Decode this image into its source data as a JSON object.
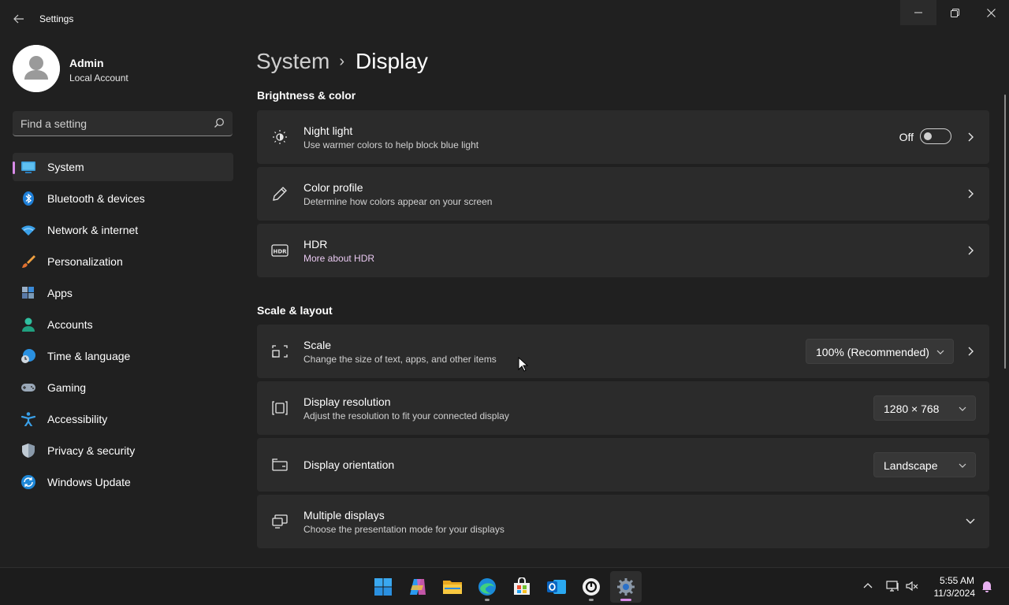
{
  "window": {
    "title": "Settings"
  },
  "profile": {
    "name": "Admin",
    "account_type": "Local Account"
  },
  "search": {
    "placeholder": "Find a setting"
  },
  "sidebar": {
    "items": [
      {
        "label": "System",
        "icon": "system-icon",
        "active": true
      },
      {
        "label": "Bluetooth & devices",
        "icon": "bluetooth-icon"
      },
      {
        "label": "Network & internet",
        "icon": "wifi-icon"
      },
      {
        "label": "Personalization",
        "icon": "brush-icon"
      },
      {
        "label": "Apps",
        "icon": "apps-icon"
      },
      {
        "label": "Accounts",
        "icon": "accounts-icon"
      },
      {
        "label": "Time & language",
        "icon": "globe-clock-icon"
      },
      {
        "label": "Gaming",
        "icon": "gamepad-icon"
      },
      {
        "label": "Accessibility",
        "icon": "accessibility-icon"
      },
      {
        "label": "Privacy & security",
        "icon": "shield-icon"
      },
      {
        "label": "Windows Update",
        "icon": "update-icon"
      }
    ]
  },
  "breadcrumb": {
    "parent": "System",
    "separator": "›",
    "current": "Display"
  },
  "sections": {
    "brightness": {
      "title": "Brightness & color",
      "night_light": {
        "label": "Night light",
        "desc": "Use warmer colors to help block blue light",
        "state": "Off",
        "on": false
      },
      "color_profile": {
        "label": "Color profile",
        "desc": "Determine how colors appear on your screen"
      },
      "hdr": {
        "label": "HDR",
        "desc": "More about HDR"
      }
    },
    "scale_layout": {
      "title": "Scale & layout",
      "scale": {
        "label": "Scale",
        "desc": "Change the size of text, apps, and other items",
        "value": "100% (Recommended)"
      },
      "resolution": {
        "label": "Display resolution",
        "desc": "Adjust the resolution to fit your connected display",
        "value": "1280 × 768"
      },
      "orientation": {
        "label": "Display orientation",
        "value": "Landscape"
      },
      "multiple": {
        "label": "Multiple displays",
        "desc": "Choose the presentation mode for your displays"
      }
    }
  },
  "taskbar": {
    "apps": [
      "start-icon",
      "copilot-icon",
      "file-explorer-icon",
      "edge-icon",
      "store-icon",
      "outlook-icon",
      "chatgpt-icon",
      "settings-icon"
    ],
    "time": "5:55 AM",
    "date": "11/3/2024"
  },
  "colors": {
    "accent": "#d88be8",
    "background": "#202020",
    "card": "#2b2b2b"
  }
}
